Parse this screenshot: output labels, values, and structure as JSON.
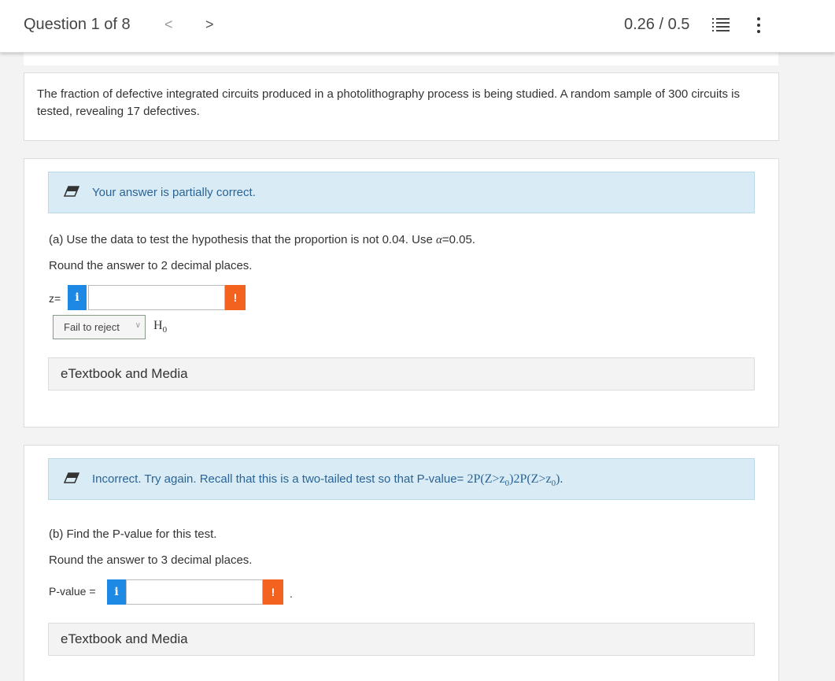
{
  "header": {
    "question_counter": "Question 1 of 8",
    "prev_glyph": "<",
    "next_glyph": ">",
    "score": "0.26 / 0.5"
  },
  "problem": {
    "statement": "The fraction of defective integrated circuits produced in a photolithography process is being studied. A random sample of 300 circuits is tested, revealing 17 defectives."
  },
  "part_a": {
    "feedback": "Your answer is partially correct.",
    "question_label": "(a)",
    "question_text_before": " Use the data to test the hypothesis that the proportion is not 0.04. Use ",
    "alpha_symbol": "α",
    "question_text_after": "=0.05.",
    "rounding": "Round the answer to 2 decimal places.",
    "z_label": "z=",
    "z_value": "",
    "decision_selected": "Fail to reject",
    "hypothesis_symbol": "H",
    "hypothesis_sub": "0",
    "etextbook": "eTextbook and Media"
  },
  "part_b": {
    "feedback_text": "Incorrect. Try again. Recall that this is a two-tailed test so that P-value= ",
    "feedback_math_a": "2P(Z>z",
    "feedback_math_sub": "0",
    "feedback_math_b": ")2P(Z>z",
    "feedback_math_sub2": "0",
    "feedback_math_c": ").",
    "question_label": "(b)",
    "question_text": " Find the P-value for this test.",
    "rounding": "Round the answer to 3 decimal places.",
    "pvalue_label": "P-value =",
    "pvalue_value": "",
    "trailing_period": ".",
    "etextbook": "eTextbook and Media"
  },
  "icons": {
    "info": "i",
    "warning": "!"
  },
  "colors": {
    "info_blue": "#1e88e5",
    "warning_orange": "#f4621f",
    "feedback_bg": "#d9ecf5",
    "feedback_text": "#2a6496"
  }
}
